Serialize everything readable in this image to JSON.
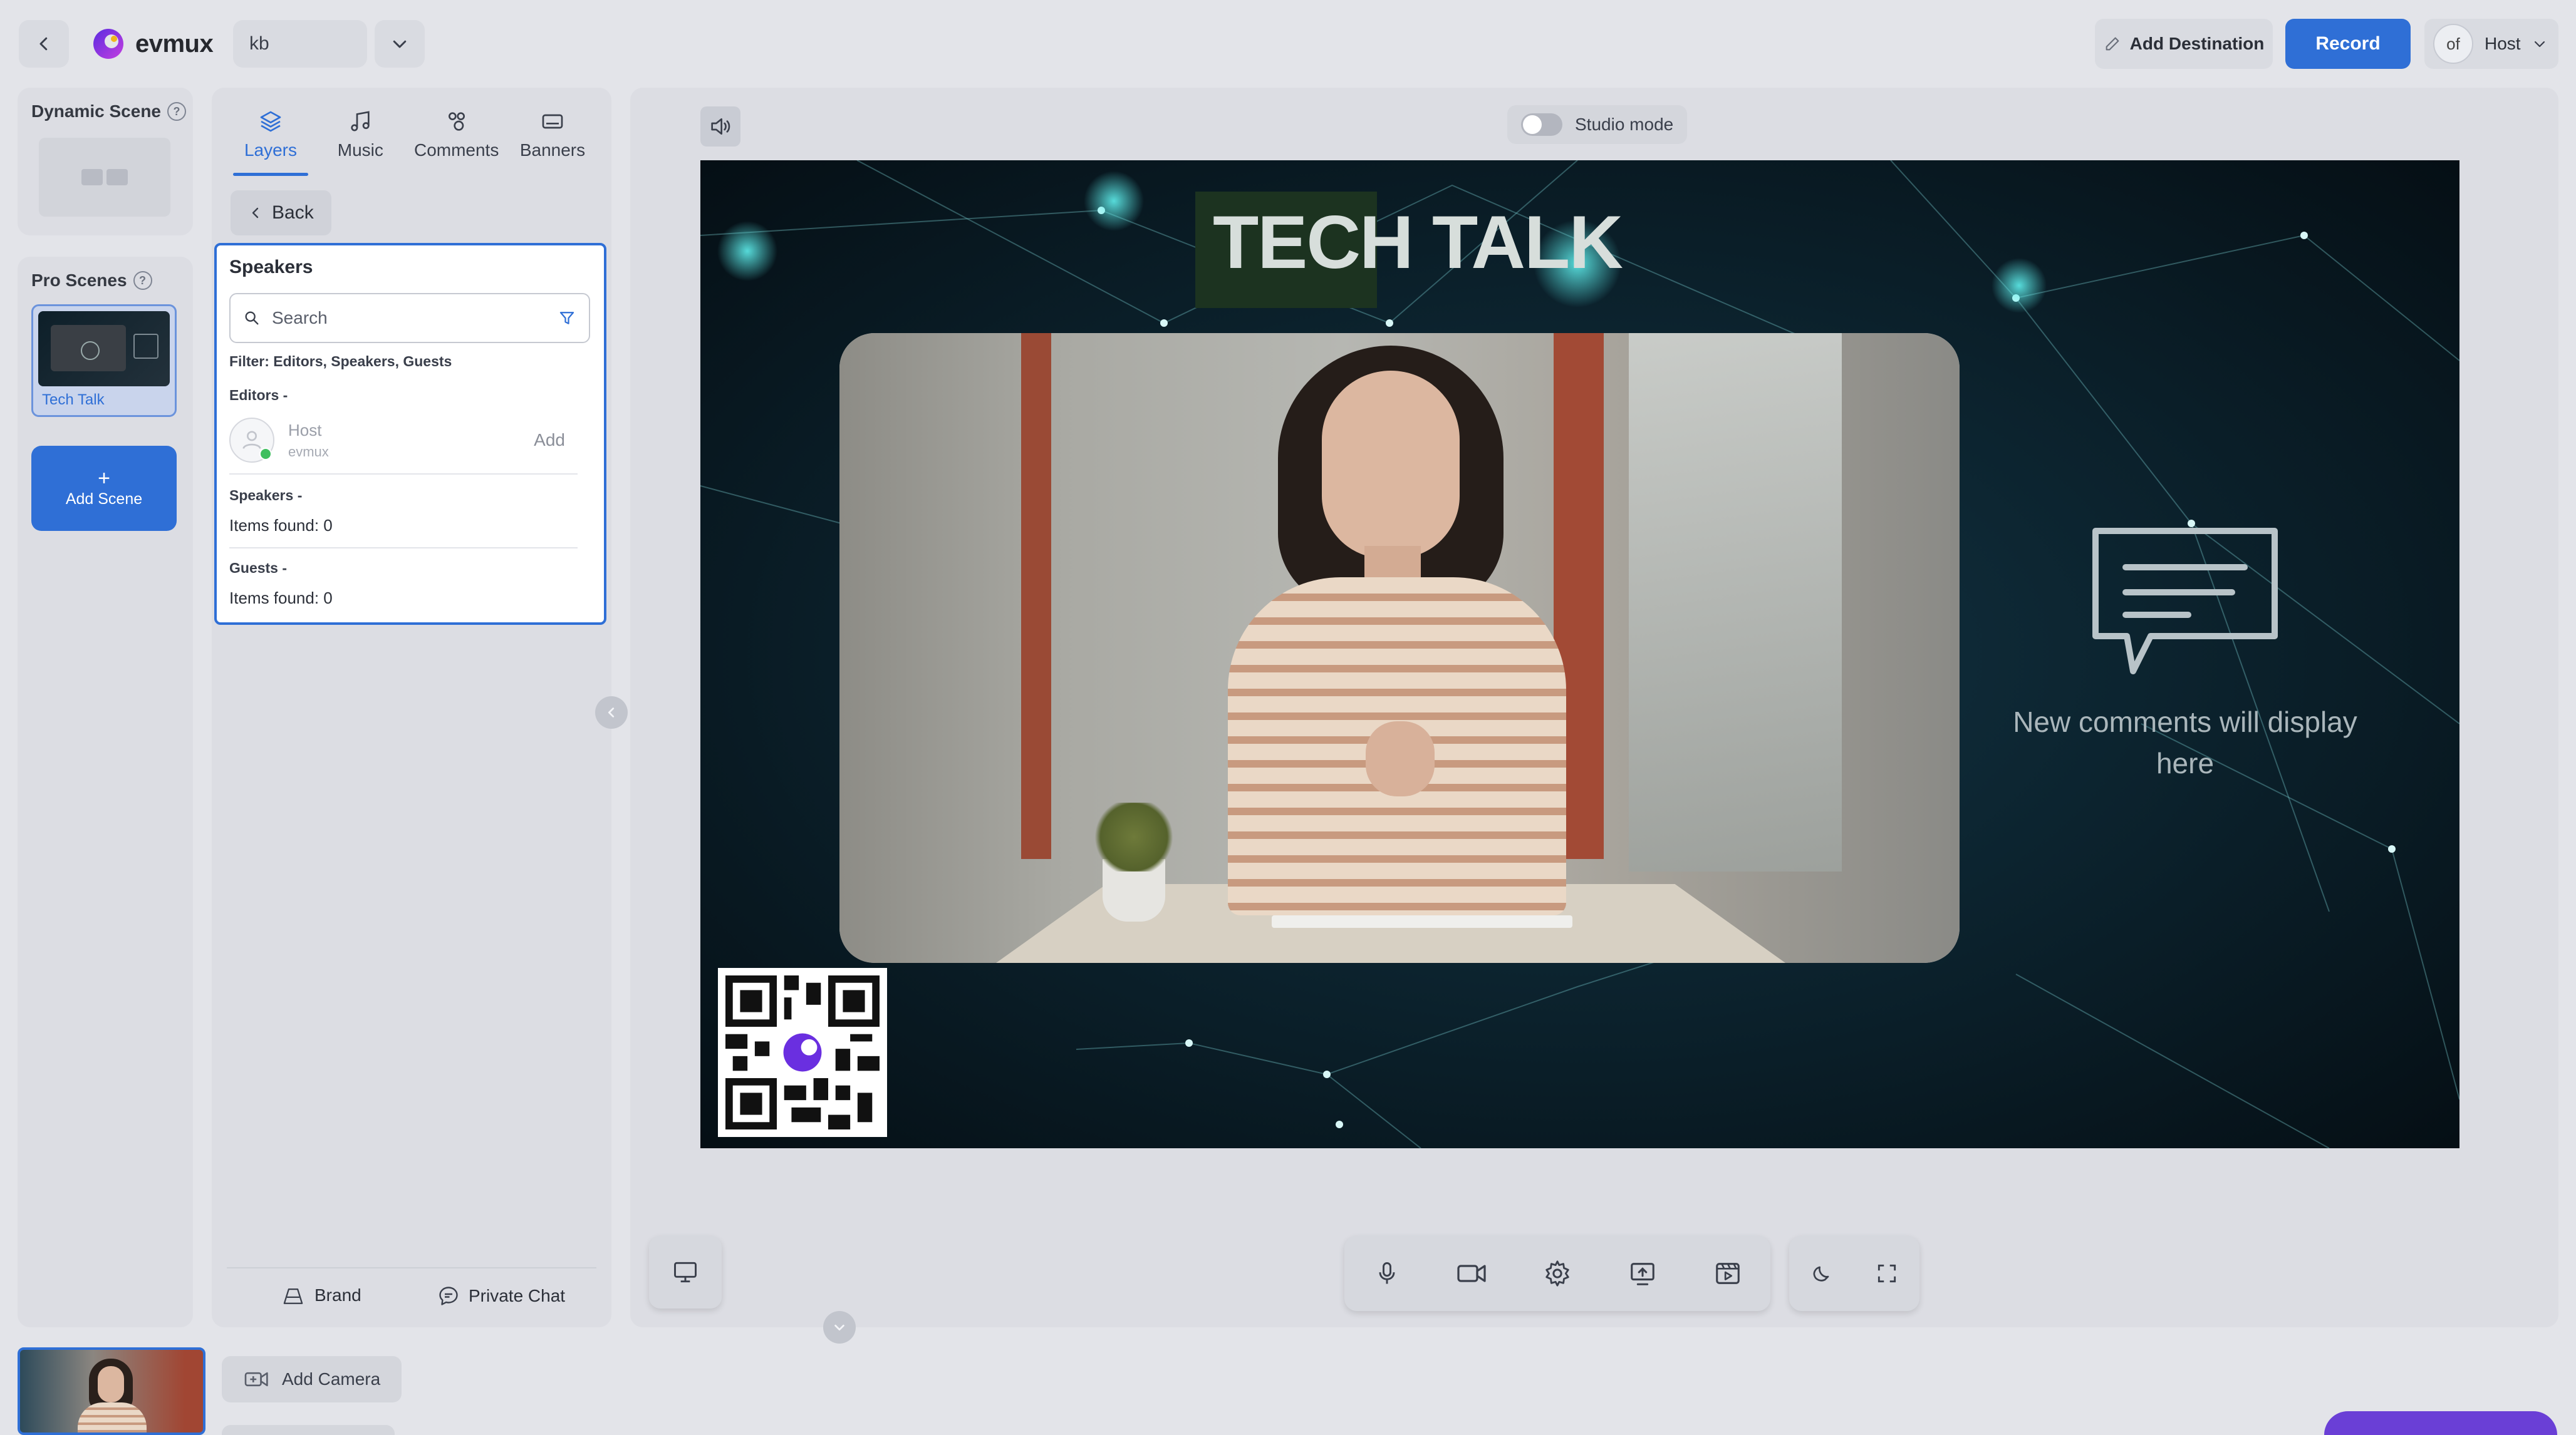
{
  "topbar": {
    "app_name": "evmux",
    "scene_name": "kb",
    "add_destination": "Add Destination",
    "record": "Record",
    "user_initials": "of",
    "user_role": "Host"
  },
  "left_rail": {
    "dynamic_scene_title": "Dynamic Scene",
    "pro_scenes_title": "Pro Scenes",
    "scene_thumbnail_label": "Tech Talk",
    "add_scene_plus": "+",
    "add_scene": "Add Scene"
  },
  "side_panel": {
    "tabs": [
      {
        "label": "Layers",
        "icon": "layers-icon"
      },
      {
        "label": "Music",
        "icon": "music-icon"
      },
      {
        "label": "Comments",
        "icon": "comments-icon"
      },
      {
        "label": "Banners",
        "icon": "banners-icon"
      }
    ],
    "back": "Back",
    "speakers": {
      "title": "Speakers",
      "search_placeholder": "Search",
      "filter_text": "Filter: Editors, Speakers, Guests",
      "editors_heading": "Editors -",
      "editor_name": "Host",
      "editor_sub": "evmux",
      "editor_action": "Add",
      "speakers_heading": "Speakers -",
      "speakers_found": "Items found: 0",
      "guests_heading": "Guests -",
      "guests_found": "Items found: 0"
    },
    "footer": {
      "brand": "Brand",
      "private_chat": "Private Chat"
    }
  },
  "stage": {
    "studio_mode": "Studio mode",
    "banner_title": "TECH TALK",
    "comments_placeholder": "New comments will display here"
  },
  "bottom": {
    "add_camera": "Add Camera"
  },
  "colors": {
    "accent": "#2f6fd6",
    "stage_bg": "#0a1a22",
    "panel_bg": "#dcdde3"
  }
}
